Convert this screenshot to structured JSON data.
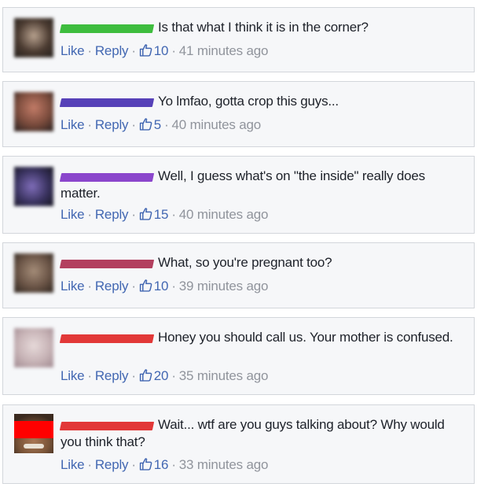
{
  "comments": [
    {
      "name_color": "#3ebd3e",
      "text": "Is that what I think it is in the corner?",
      "like": "Like",
      "reply": "Reply",
      "likes": "10",
      "time": "41 minutes ago",
      "avatar_colors": [
        "#b7a18e",
        "#4b3b31",
        "#2d2520"
      ]
    },
    {
      "name_color": "#5641b8",
      "text": "Yo lmfao, gotta crop this guys...",
      "like": "Like",
      "reply": "Reply",
      "likes": "5",
      "time": "40 minutes ago",
      "avatar_colors": [
        "#c27b67",
        "#7a4b3c",
        "#3a2a26"
      ]
    },
    {
      "name_color": "#8b46cc",
      "text": "Well, I guess what's on \"the inside\" really does matter.",
      "like": "Like",
      "reply": "Reply",
      "likes": "15",
      "time": "40 minutes ago",
      "avatar_colors": [
        "#7f6db9",
        "#3a3360",
        "#1e1c2e"
      ]
    },
    {
      "name_color": "#b3405f",
      "text": "What, so you're pregnant too?",
      "like": "Like",
      "reply": "Reply",
      "likes": "10",
      "time": "39 minutes ago",
      "avatar_colors": [
        "#a48c78",
        "#6a5446",
        "#3c3028"
      ]
    },
    {
      "name_color": "#e23838",
      "text": "Honey you should call us. Your mother is confused.",
      "like": "Like",
      "reply": "Reply",
      "likes": "20",
      "time": "35 minutes ago",
      "avatar_colors": [
        "#e6d9d9",
        "#c7b3b6",
        "#a99399"
      ]
    },
    {
      "name_color": "#e23838",
      "text": "Wait... wtf are you guys talking about? Why would you think that?",
      "like": "Like",
      "reply": "Reply",
      "likes": "16",
      "time": "33 minutes ago",
      "avatar_colors": [
        "#ff0000",
        "#8a5b3c",
        "#3b2a1f"
      ]
    }
  ]
}
